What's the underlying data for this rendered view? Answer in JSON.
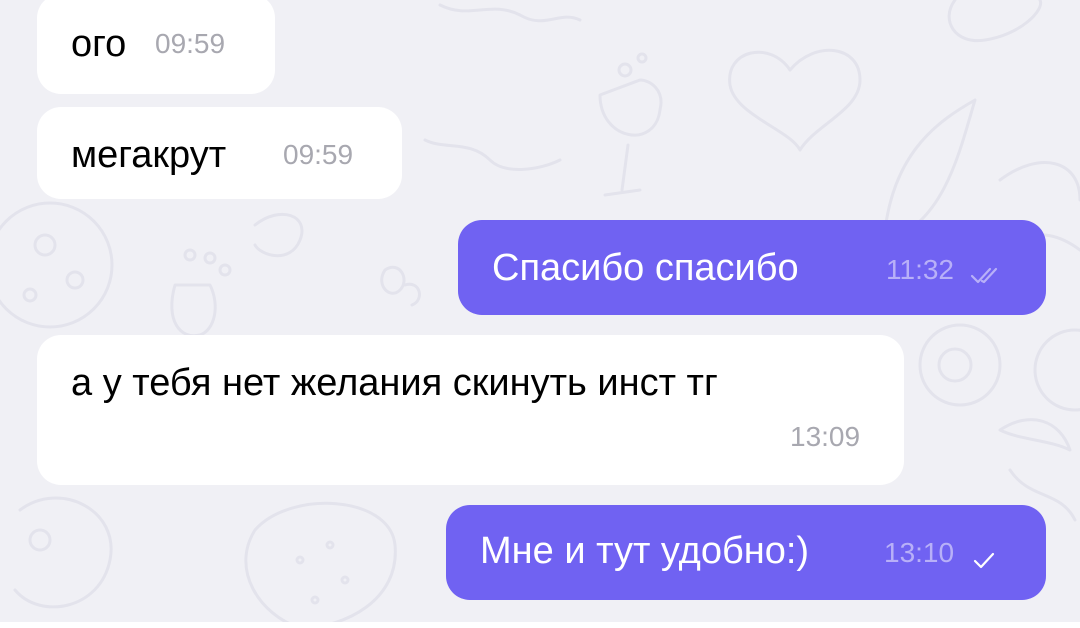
{
  "theme": {
    "wallpaper": "#f0f0f5",
    "incoming_bubble": "#ffffff",
    "outgoing_bubble": "#7062f2",
    "incoming_time": "#a8a8b0",
    "outgoing_time": "#b8b0f8"
  },
  "messages": [
    {
      "direction": "incoming",
      "text": "ого",
      "time": "09:59"
    },
    {
      "direction": "incoming",
      "text": "мегакрут",
      "time": "09:59"
    },
    {
      "direction": "outgoing",
      "text": "Спасибо спасибо",
      "time": "11:32",
      "status": "read",
      "status_icon": "double-check-icon"
    },
    {
      "direction": "incoming",
      "text": "а у тебя нет желания скинуть инст тг",
      "time": "13:09"
    },
    {
      "direction": "outgoing",
      "text": "Мне и тут удобно:)",
      "time": "13:10",
      "status": "delivered",
      "status_icon": "check-icon"
    }
  ]
}
